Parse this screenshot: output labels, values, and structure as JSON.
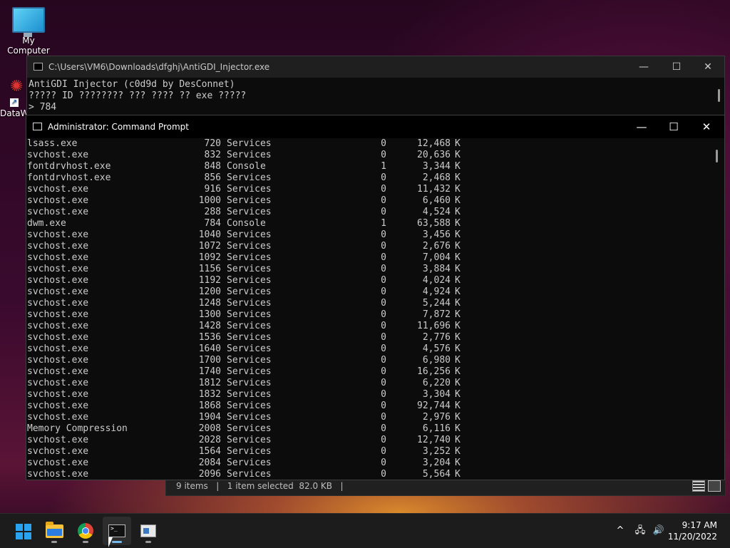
{
  "desktop": {
    "icons": [
      {
        "label": "My Computer"
      },
      {
        "label": "DataW"
      }
    ]
  },
  "explorer_back": {
    "status": "9 items   |   1 item selected  82.0 KB   |"
  },
  "injector": {
    "title": "C:\\Users\\VM6\\Downloads\\dfghj\\AntiGDI_Injector.exe",
    "lines": [
      "AntiGDI Injector (c0d9d by DesConnet)",
      "????? ID ???????? ??? ???? ?? exe ?????",
      "> 784"
    ]
  },
  "cmd": {
    "title": "Administrator: Command Prompt",
    "buttons": {
      "minimize": "—",
      "maximize": "☐",
      "close": "✕"
    },
    "rows": [
      [
        "lsass.exe",
        "720",
        "Services",
        "0",
        "12,468",
        "K"
      ],
      [
        "svchost.exe",
        "832",
        "Services",
        "0",
        "20,636",
        "K"
      ],
      [
        "fontdrvhost.exe",
        "848",
        "Console",
        "1",
        "3,344",
        "K"
      ],
      [
        "fontdrvhost.exe",
        "856",
        "Services",
        "0",
        "2,468",
        "K"
      ],
      [
        "svchost.exe",
        "916",
        "Services",
        "0",
        "11,432",
        "K"
      ],
      [
        "svchost.exe",
        "1000",
        "Services",
        "0",
        "6,460",
        "K"
      ],
      [
        "svchost.exe",
        "288",
        "Services",
        "0",
        "4,524",
        "K"
      ],
      [
        "dwm.exe",
        "784",
        "Console",
        "1",
        "63,588",
        "K"
      ],
      [
        "svchost.exe",
        "1040",
        "Services",
        "0",
        "3,456",
        "K"
      ],
      [
        "svchost.exe",
        "1072",
        "Services",
        "0",
        "2,676",
        "K"
      ],
      [
        "svchost.exe",
        "1092",
        "Services",
        "0",
        "7,004",
        "K"
      ],
      [
        "svchost.exe",
        "1156",
        "Services",
        "0",
        "3,884",
        "K"
      ],
      [
        "svchost.exe",
        "1192",
        "Services",
        "0",
        "4,024",
        "K"
      ],
      [
        "svchost.exe",
        "1200",
        "Services",
        "0",
        "4,924",
        "K"
      ],
      [
        "svchost.exe",
        "1248",
        "Services",
        "0",
        "5,244",
        "K"
      ],
      [
        "svchost.exe",
        "1300",
        "Services",
        "0",
        "7,872",
        "K"
      ],
      [
        "svchost.exe",
        "1428",
        "Services",
        "0",
        "11,696",
        "K"
      ],
      [
        "svchost.exe",
        "1536",
        "Services",
        "0",
        "2,776",
        "K"
      ],
      [
        "svchost.exe",
        "1640",
        "Services",
        "0",
        "4,576",
        "K"
      ],
      [
        "svchost.exe",
        "1700",
        "Services",
        "0",
        "6,980",
        "K"
      ],
      [
        "svchost.exe",
        "1740",
        "Services",
        "0",
        "16,256",
        "K"
      ],
      [
        "svchost.exe",
        "1812",
        "Services",
        "0",
        "6,220",
        "K"
      ],
      [
        "svchost.exe",
        "1832",
        "Services",
        "0",
        "3,304",
        "K"
      ],
      [
        "svchost.exe",
        "1868",
        "Services",
        "0",
        "92,744",
        "K"
      ],
      [
        "svchost.exe",
        "1904",
        "Services",
        "0",
        "2,976",
        "K"
      ],
      [
        "Memory Compression",
        "2008",
        "Services",
        "0",
        "6,116",
        "K"
      ],
      [
        "svchost.exe",
        "2028",
        "Services",
        "0",
        "12,740",
        "K"
      ],
      [
        "svchost.exe",
        "1564",
        "Services",
        "0",
        "3,252",
        "K"
      ],
      [
        "svchost.exe",
        "2084",
        "Services",
        "0",
        "3,204",
        "K"
      ],
      [
        "svchost.exe",
        "2096",
        "Services",
        "0",
        "5,564",
        "K"
      ]
    ]
  },
  "taskbar": {
    "apps": [
      {
        "name": "start-icon"
      },
      {
        "name": "file-explorer-icon"
      },
      {
        "name": "chrome-icon"
      },
      {
        "name": "command-prompt-icon"
      },
      {
        "name": "app-window-icon"
      }
    ],
    "tray": {
      "chevron": "^",
      "network": "🖧",
      "volume": "🔊"
    },
    "time": "9:17 AM",
    "date": "11/20/2022"
  },
  "colors": {
    "console_text": "#cccccc",
    "console_bg": "#0c0c0c",
    "accent": "#29a3f0"
  }
}
